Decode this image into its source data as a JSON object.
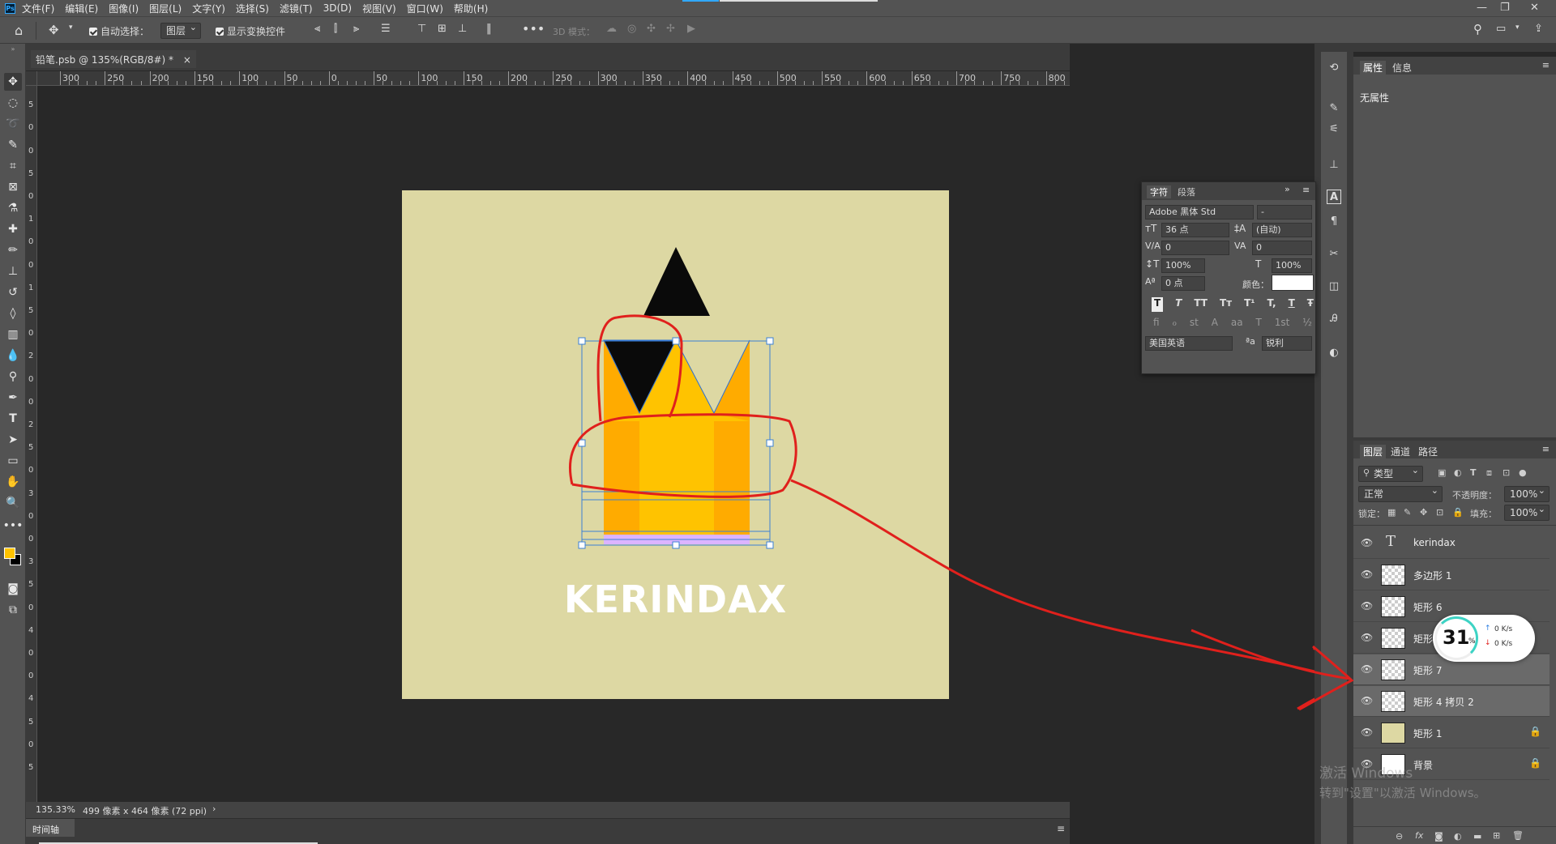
{
  "app": {
    "logo": "Ps"
  },
  "menu": [
    "文件(F)",
    "编辑(E)",
    "图像(I)",
    "图层(L)",
    "文字(Y)",
    "选择(S)",
    "滤镜(T)",
    "3D(D)",
    "视图(V)",
    "窗口(W)",
    "帮助(H)"
  ],
  "window_controls": {
    "minimize": "—",
    "restore": "❐",
    "close": "✕"
  },
  "options": {
    "auto_select_label": "自动选择：",
    "auto_select_value": "图层",
    "show_transform_label": "显示变换控件",
    "mode_3d_label": "3D 模式："
  },
  "document": {
    "tab_title": "铅笔.psb @ 135%(RGB/8#) *",
    "close": "×"
  },
  "ruler": {
    "h_labels": [
      "300",
      "250",
      "200",
      "150",
      "100",
      "50",
      "0",
      "50",
      "100",
      "150",
      "200",
      "250",
      "300",
      "350",
      "400",
      "450",
      "500",
      "550",
      "600",
      "650",
      "700",
      "750",
      "800"
    ],
    "v_labels": [
      "1",
      "5",
      "0",
      "0",
      "5",
      "0",
      "1",
      "0",
      "0",
      "1",
      "5",
      "0",
      "2",
      "0",
      "0",
      "2",
      "5",
      "0",
      "3",
      "0",
      "0",
      "3",
      "5",
      "0",
      "4",
      "0",
      "0",
      "4",
      "5",
      "0",
      "5"
    ]
  },
  "canvas": {
    "text": "KERINDAX",
    "bg_color": "#ddd8a3",
    "accent_yellow": "#ffc300",
    "accent_orange": "#ffab00",
    "selection_purple": "#dcb4ff",
    "annotation_red": "#e0201c"
  },
  "status": {
    "zoom": "135.33%",
    "doc_info": "499 像素 x 464 像素 (72 ppi)",
    "arrow": "›"
  },
  "timeline": {
    "label": "时间轴"
  },
  "properties_panel": {
    "tabs": [
      "属性",
      "信息"
    ],
    "content": "无属性"
  },
  "character_panel": {
    "tabs": [
      "字符",
      "段落"
    ],
    "font_family": "Adobe 黑体 Std",
    "font_style": "-",
    "font_size": "36 点",
    "leading": "(自动)",
    "kerning": "0",
    "tracking": "0",
    "vscale": "100%",
    "hscale": "100%",
    "baseline": "0 点",
    "color_label": "颜色：",
    "style_buttons": [
      "T",
      "T",
      "TT",
      "Tт",
      "T¹",
      "T,",
      "T",
      "Ŧ"
    ],
    "opentype_buttons": [
      "ﬁ",
      "ℴ",
      "st",
      "A",
      "aa",
      "T",
      "1st",
      "½"
    ],
    "language": "美国英语",
    "aa_label": "ªa",
    "antialias": "锐利"
  },
  "layers_panel": {
    "tabs": [
      "图层",
      "通道",
      "路径"
    ],
    "filter_label": "类型",
    "blend_mode": "正常",
    "opacity_label": "不透明度：",
    "opacity_value": "100%",
    "lock_label": "锁定：",
    "fill_label": "填充：",
    "fill_value": "100%",
    "layers": [
      {
        "name": "kerindax",
        "type": "text",
        "selected": false,
        "locked": false
      },
      {
        "name": "多边形 1",
        "type": "shape",
        "selected": false,
        "locked": false
      },
      {
        "name": "矩形 6",
        "type": "shape",
        "selected": false,
        "locked": false
      },
      {
        "name": "矩形",
        "type": "shape",
        "selected": false,
        "locked": false
      },
      {
        "name": "矩形 7",
        "type": "shape",
        "selected": true,
        "locked": false
      },
      {
        "name": "矩形 4 拷贝 2",
        "type": "shape",
        "selected": true,
        "locked": false
      },
      {
        "name": "矩形 1",
        "type": "shape",
        "selected": false,
        "locked": true
      },
      {
        "name": "背景",
        "type": "background",
        "selected": false,
        "locked": true
      }
    ],
    "footer_icons": [
      "link-icon",
      "fx-icon",
      "mask-icon",
      "adjustment-icon",
      "folder-icon",
      "new-layer-icon",
      "trash-icon"
    ]
  },
  "network_widget": {
    "percent": "31",
    "percent_sign": "%",
    "up": "0 K/s",
    "down": "0 K/s"
  },
  "watermark": {
    "line1": "激活 Windows",
    "line2": "转到\"设置\"以激活 Windows。"
  }
}
